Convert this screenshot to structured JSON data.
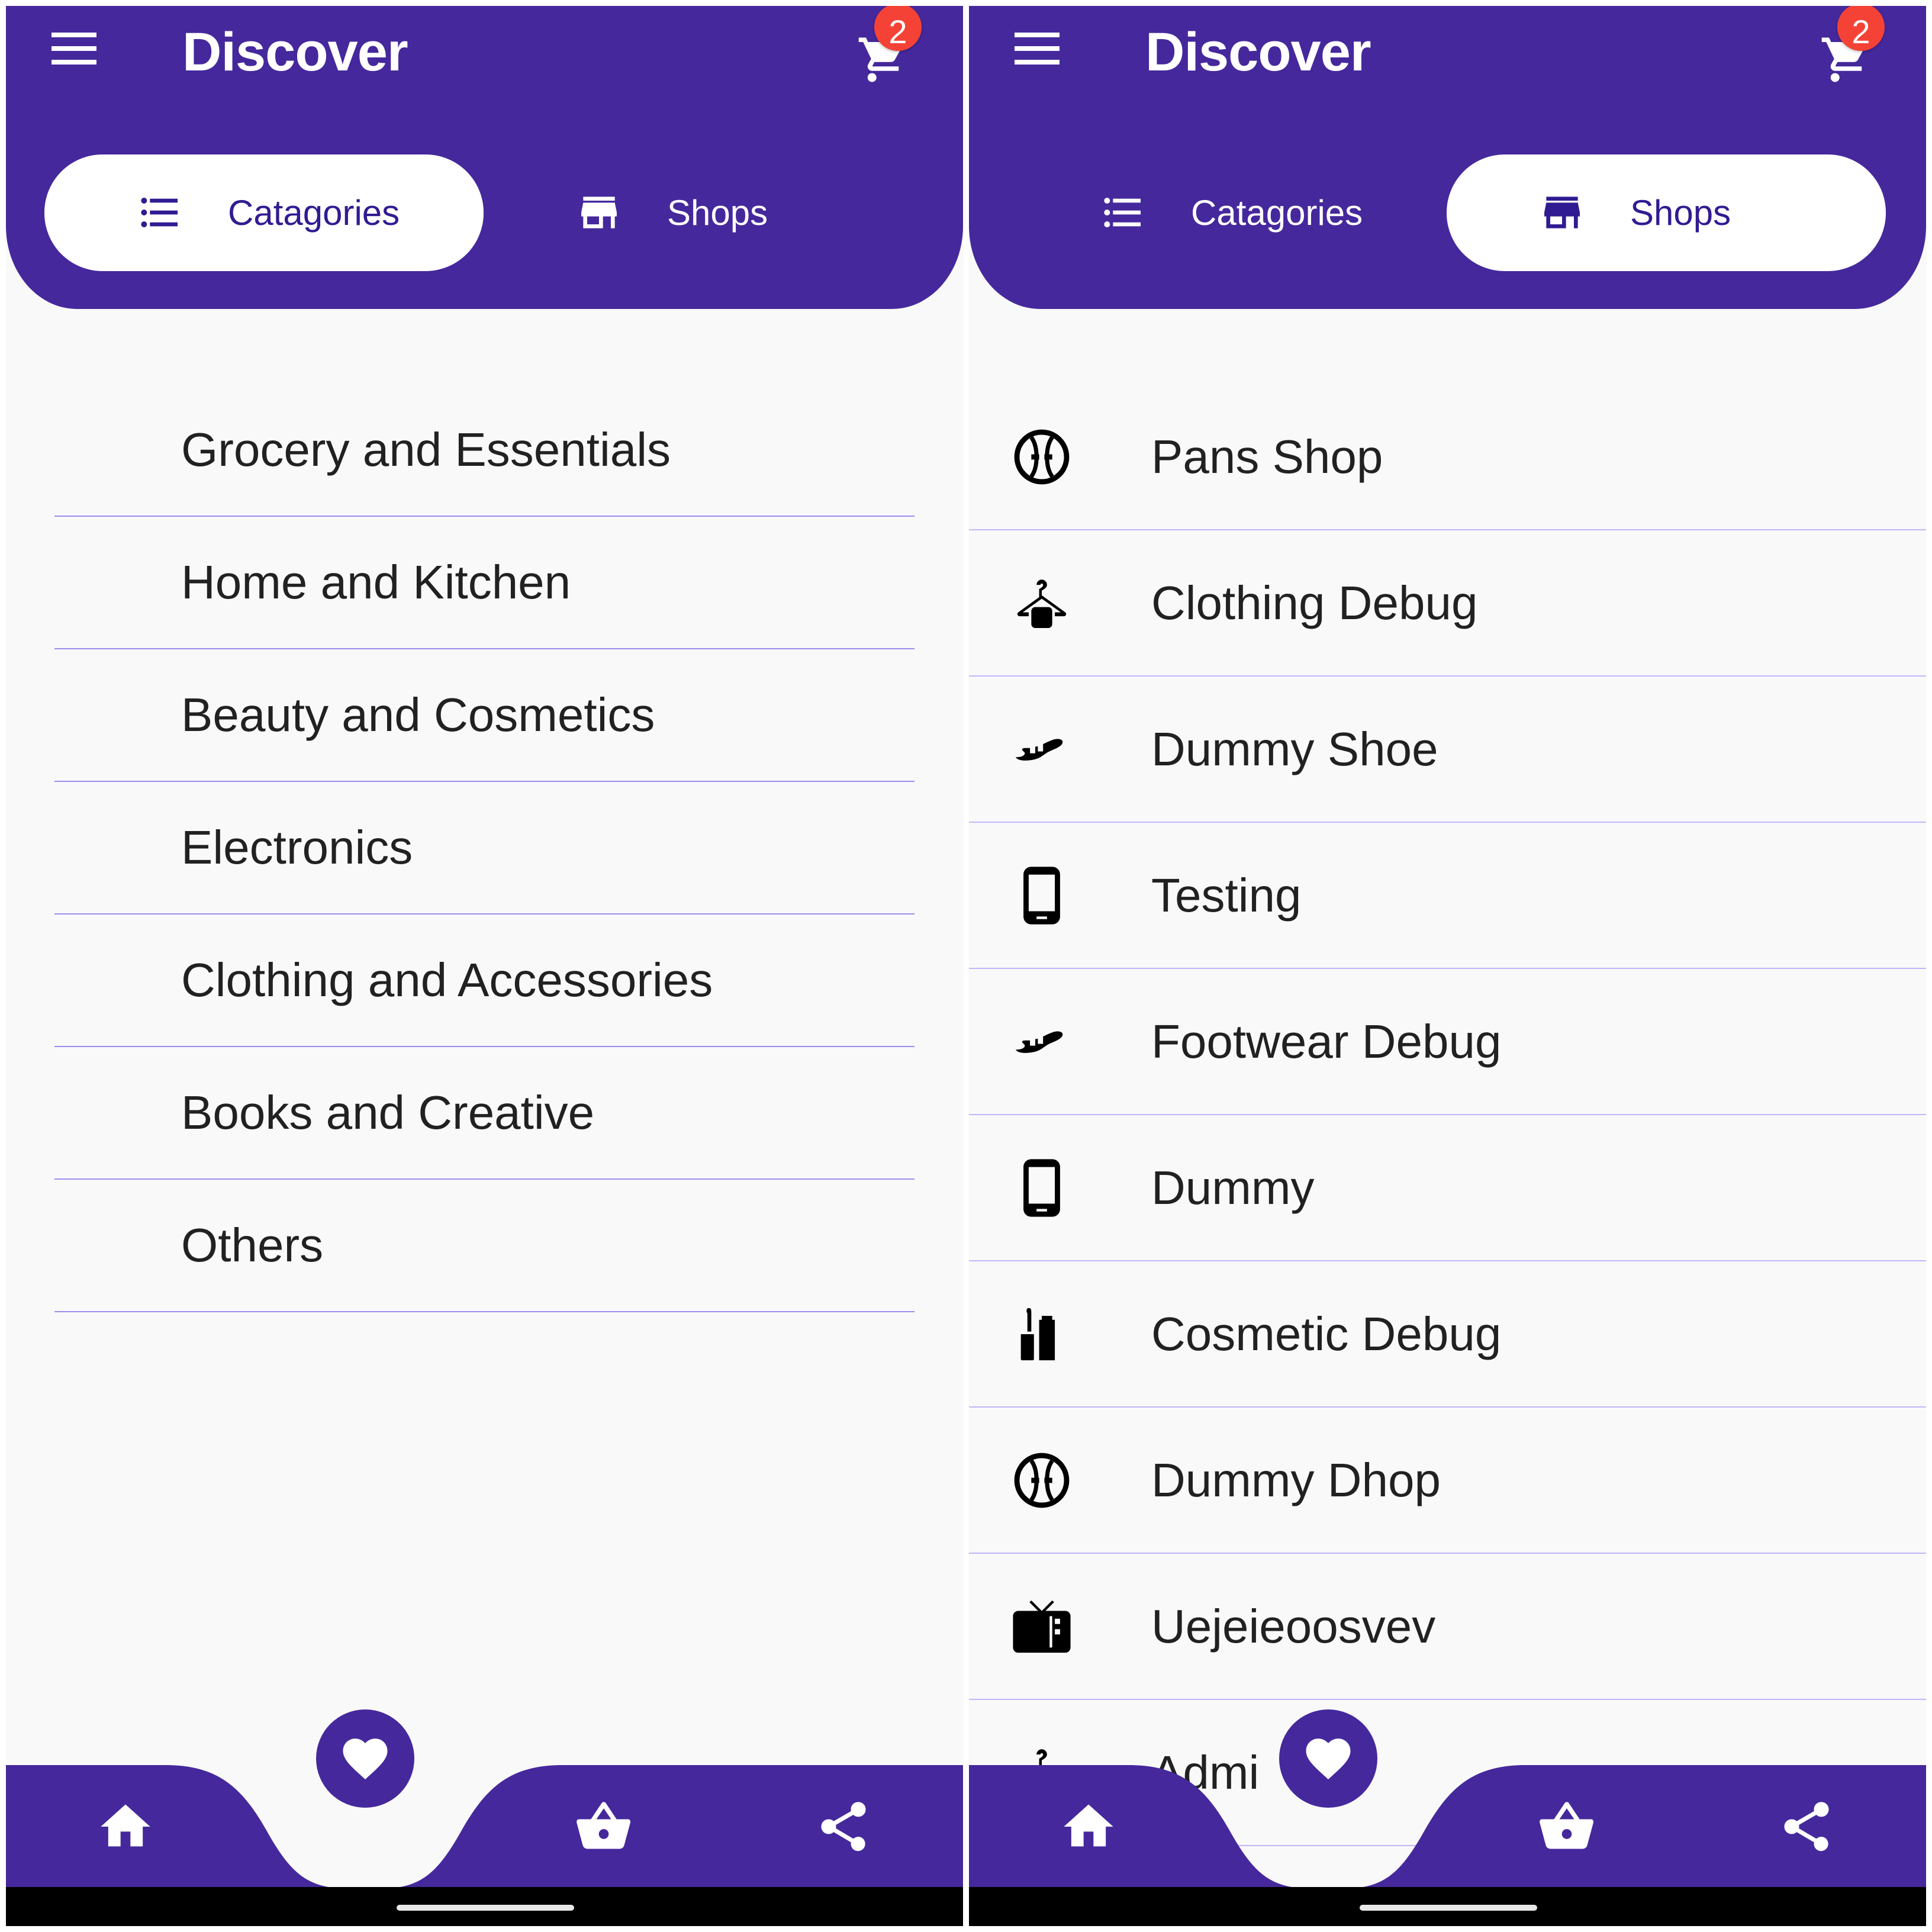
{
  "colors": {
    "primary": "#45289c",
    "tab_text_active": "#311b92",
    "badge": "#f44336",
    "divider_left": "#9b8cf0",
    "divider_right": "#c3b5fb",
    "list_text": "#212121",
    "background": "#f9f9f9"
  },
  "screens": [
    {
      "header": {
        "menu_icon": "hamburger-menu-icon",
        "title": "Discover",
        "cart_icon": "shopping-cart-icon",
        "cart_badge": "2"
      },
      "tabs": [
        {
          "label": "Catagories",
          "icon": "list-bulleted-icon",
          "active": true
        },
        {
          "label": "Shops",
          "icon": "storefront-icon",
          "active": false
        }
      ],
      "categories": [
        "Grocery and Essentials",
        "Home and Kitchen",
        "Beauty and Cosmetics",
        "Electronics",
        "Clothing and Accessories",
        "Books and Creative",
        "Others"
      ]
    },
    {
      "header": {
        "menu_icon": "hamburger-menu-icon",
        "title": "Discover",
        "cart_icon": "shopping-cart-icon",
        "cart_badge": "2"
      },
      "tabs": [
        {
          "label": "Catagories",
          "icon": "list-bulleted-icon",
          "active": false
        },
        {
          "label": "Shops",
          "icon": "storefront-icon",
          "active": true
        }
      ],
      "shops": [
        {
          "name": "Pans Shop",
          "icon": "baseball-icon"
        },
        {
          "name": "Clothing Debug",
          "icon": "hanger-icon"
        },
        {
          "name": "Dummy Shoe",
          "icon": "shoe-icon"
        },
        {
          "name": "Testing",
          "icon": "smartphone-icon"
        },
        {
          "name": "Footwear Debug",
          "icon": "shoe-icon"
        },
        {
          "name": "Dummy",
          "icon": "smartphone-icon"
        },
        {
          "name": "Cosmetic Debug",
          "icon": "lipstick-icon"
        },
        {
          "name": "Dummy Dhop",
          "icon": "baseball-icon"
        },
        {
          "name": "Uejeieoosvev",
          "icon": "tv-icon"
        },
        {
          "name": "Admi",
          "icon": "hanger-icon"
        }
      ]
    }
  ],
  "bottom_nav": [
    {
      "name": "home",
      "icon": "home-icon"
    },
    {
      "name": "favorites",
      "icon": "heart-icon",
      "active": true
    },
    {
      "name": "basket",
      "icon": "shopping-basket-icon"
    },
    {
      "name": "share",
      "icon": "share-icon"
    }
  ]
}
